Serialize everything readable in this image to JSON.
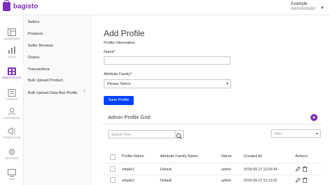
{
  "brand": {
    "name": "bagisto",
    "color": "#7b2fb9"
  },
  "user": {
    "name": "Example",
    "role": "Administrator"
  },
  "left_nav": [
    {
      "label": "DASHBOARD",
      "icon": "dashboard-icon"
    },
    {
      "label": "SALES",
      "icon": "sales-icon"
    },
    {
      "label": "MARKETPLACE",
      "icon": "marketplace-icon",
      "active": true
    },
    {
      "label": "CATALOG",
      "icon": "catalog-icon"
    },
    {
      "label": "CUSTOMERS",
      "icon": "customers-icon"
    },
    {
      "label": "PROMOTIONS",
      "icon": "promotions-icon"
    },
    {
      "label": "SETTINGS",
      "icon": "settings-icon"
    },
    {
      "label": "CMS",
      "icon": "cms-icon"
    }
  ],
  "sub_nav": [
    "Sellers",
    "Products",
    "Seller Reviews",
    "Orders",
    "Transactions",
    "Bulk Upload Product",
    "Bulk Upload Data flow Profile"
  ],
  "form": {
    "title": "Add Profile",
    "section": "Profile Information",
    "name_label": "Name*",
    "attribute_label": "Attribute Family*",
    "attribute_value": "Please Select",
    "save_label": "Save Profile"
  },
  "grid": {
    "title": "Admin Profile Grid",
    "search_placeholder": "Search Here...",
    "filter_placeholder": "Filter",
    "columns": [
      "Profile Name",
      "Attribute Family Name",
      "Name",
      "Created At",
      "Actions"
    ],
    "rows": [
      {
        "profile": "simple1",
        "family": "Default",
        "name": "admin",
        "created": "2019-09-17 12:03:34"
      },
      {
        "profile": "simple2",
        "family": "Default",
        "name": "admin",
        "created": "2019-09-17 12:13:10"
      }
    ]
  },
  "colors": {
    "accent": "#7b2fb9",
    "primary_button": "#0041ff"
  }
}
